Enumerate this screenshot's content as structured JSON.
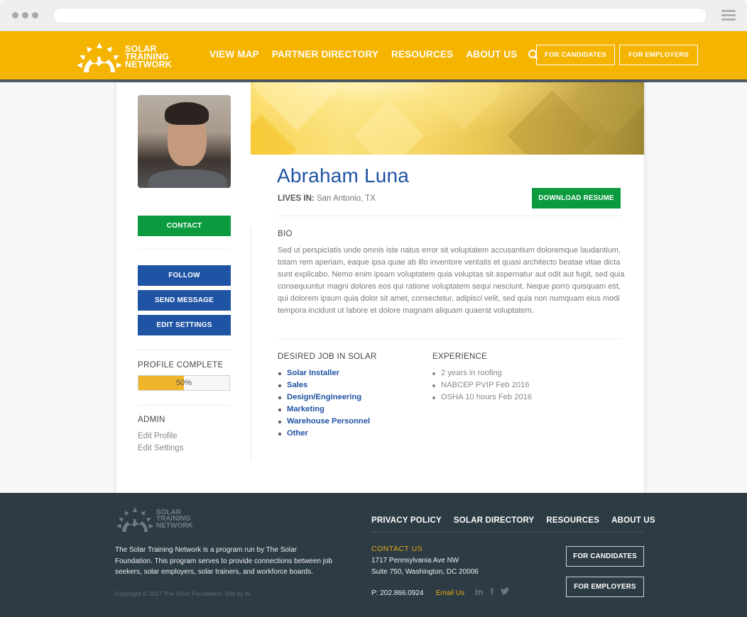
{
  "browser": {
    "url": "",
    "menu_icon": "hamburger-icon"
  },
  "header": {
    "logo": {
      "line1": "SOLAR",
      "line2": "TRAINING",
      "line3": "NETWORK",
      "icon": "sun-people-logo-icon"
    },
    "nav": [
      {
        "label": "VIEW MAP"
      },
      {
        "label": "PARTNER DIRECTORY"
      },
      {
        "label": "RESOURCES"
      },
      {
        "label": "ABOUT US"
      }
    ],
    "search_icon": "search-icon",
    "buttons": {
      "candidates": "FOR CANDIDATES",
      "employers": "FOR EMPLOYERS"
    },
    "colors": {
      "brand_yellow": "#f5b400",
      "accent_bar": "#4c5864"
    }
  },
  "profile": {
    "name": "Abraham Luna",
    "lives_in_label": "LIVES IN:",
    "lives_in_value": "San Antonio, TX",
    "download_resume": "DOWNLOAD RESUME",
    "bio_heading": "BIO",
    "bio": "Sed ut perspiciatis unde omnis iste natus error sit voluptatem accusantium doloremque laudantium, totam rem aperiam, eaque ipsa quae ab illo inventore veritatis et quasi architecto beatae vitae dicta sunt explicabo. Nemo enim ipsam voluptatem quia voluptas sit aspernatur aut odit aut fugit, sed quia consequuntur magni dolores eos qui ratione voluptatem sequi nesciunt. Neque porro quisquam est, qui dolorem ipsum quia dolor sit amet, consectetur, adipisci velit, sed quia non numquam eius modi tempora incidunt ut labore et dolore magnam aliquam quaerat voluptatem.",
    "desired_jobs_heading": "DESIRED JOB IN SOLAR",
    "desired_jobs": [
      "Solar Installer",
      "Sales",
      "Design/Engineering",
      "Marketing",
      "Warehouse Personnel",
      "Other"
    ],
    "experience_heading": "EXPERIENCE",
    "experience": [
      "2 years in roofing",
      "NABCEP PVIP Feb 2016",
      "OSHA 10 hours Feb 2016"
    ]
  },
  "sidebar": {
    "contact": "CONTACT",
    "follow": "FOLLOW",
    "send_message": "SEND MESSAGE",
    "edit_settings": "EDIT SETTINGS",
    "profile_complete_heading": "PROFILE COMPLETE",
    "profile_complete_percent": 50,
    "profile_complete_label": "50%",
    "admin_heading": "ADMIN",
    "admin_links": [
      "Edit Profile",
      "Edit Settings"
    ],
    "colors": {
      "green": "#0b9a3d",
      "blue": "#1f53a3",
      "progress": "#f0b52a"
    }
  },
  "footer": {
    "logo": {
      "line1": "SOLAR",
      "line2": "TRAINING",
      "line3": "NETWORK"
    },
    "about": "The Solar Training Network is a program run by The Solar Foundation. This program serves to provide connections between job seekers, solar employers, solar trainers, and workforce boards.",
    "copyright": "Copyright © 2017 The Solar Foundation. Site by AI",
    "nav": [
      {
        "label": "PRIVACY POLICY"
      },
      {
        "label": "SOLAR DIRECTORY"
      },
      {
        "label": "RESOURCES"
      },
      {
        "label": "ABOUT US"
      }
    ],
    "contact_heading": "CONTACT US",
    "address_line1": "1717 Pennsylvania Ave NW",
    "address_line2": "Suite 750, Washington, DC 20006",
    "phone": "P: 202.866.0924",
    "email_link": "Email Us",
    "social": [
      {
        "icon": "linkedin-icon",
        "glyph": "in"
      },
      {
        "icon": "facebook-icon",
        "glyph": "f"
      },
      {
        "icon": "twitter-icon",
        "glyph": "🐦"
      }
    ],
    "buttons": {
      "candidates": "FOR CANDIDATES",
      "employers": "FOR EMPLOYERS"
    },
    "colors": {
      "background": "#2d3b44",
      "accent": "#e5aa16"
    }
  }
}
